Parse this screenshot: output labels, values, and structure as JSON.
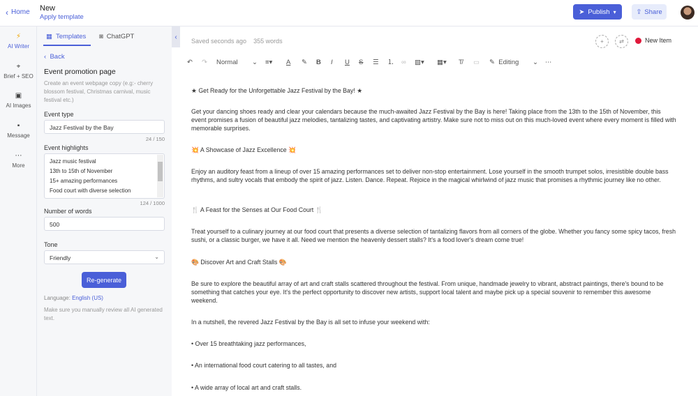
{
  "header": {
    "home_label": "Home",
    "doc_title": "New",
    "apply_template": "Apply template",
    "publish_label": "Publish",
    "share_label": "Share",
    "colors": {
      "accent": "#4a5fd8",
      "share_bg": "#e7ecfb"
    }
  },
  "rail": {
    "items": [
      {
        "label": "AI Writer",
        "icon": "bolt-icon"
      },
      {
        "label": "Brief + SEO",
        "icon": "target-icon"
      },
      {
        "label": "AI Images",
        "icon": "image-icon"
      },
      {
        "label": "Message",
        "icon": "chat-icon"
      },
      {
        "label": "More",
        "icon": "more-icon"
      }
    ]
  },
  "panel": {
    "tabs": [
      {
        "label": "Templates",
        "icon": "grid-icon"
      },
      {
        "label": "ChatGPT",
        "icon": "chat-bubbles-icon"
      }
    ],
    "back_label": "Back",
    "heading": "Event promotion page",
    "description": "Create an event webpage copy (e.g:- cherry blossom festival, Christmas carnival, music festival etc.)",
    "event_type_label": "Event type",
    "event_type_value": "Jazz Festival by the Bay",
    "event_type_count": "24 / 150",
    "highlights_label": "Event highlights",
    "highlights_lines": [
      "Jazz music festival",
      "13th to 15th of November",
      "15+ amazing performances",
      "Food court with diverse selection"
    ],
    "highlights_count": "124 / 1000",
    "words_label": "Number of words",
    "words_value": "500",
    "tone_label": "Tone",
    "tone_value": "Friendly",
    "regenerate_label": "Re-generate",
    "language_label": "Language:",
    "language_value": "English (US)",
    "note": "Make sure you manually review all AI generated text."
  },
  "editor": {
    "saved_status": "Saved seconds ago",
    "word_count": "355 words",
    "new_item_label": "New Item",
    "status_color": "#e0193b",
    "toolbar": {
      "style": "Normal",
      "mode": "Editing",
      "more": "⋯"
    },
    "paragraphs": [
      "★ Get Ready for the Unforgettable Jazz Festival by the Bay! ★",
      "Get your dancing shoes ready and clear your calendars because the much-awaited Jazz Festival by the Bay is here! Taking place from the 13th to the 15th of November, this event promises a fusion of beautiful jazz melodies, tantalizing tastes, and captivating artistry. Make sure not to miss out on this much-loved event where every moment is filled with memorable surprises.",
      "💥 A Showcase of Jazz Excellence 💥",
      "Enjoy an auditory feast from a lineup of over 15 amazing performances set to deliver non-stop entertainment. Lose yourself in the smooth trumpet solos, irresistible double bass rhythms, and sultry vocals that embody the spirit of jazz. Listen. Dance. Repeat. Rejoice in the magical whirlwind of jazz music that promises a rhythmic journey like no other.",
      "🍴 A Feast for the Senses at Our Food Court 🍴",
      "Treat yourself to a culinary journey at our food court that presents a diverse selection of tantalizing flavors from all corners of the globe. Whether you fancy some spicy tacos, fresh sushi, or a classic burger, we have it all. Need we mention the heavenly dessert stalls? It's a food lover's dream come true!",
      "🎨 Discover Art and Craft Stalls 🎨",
      "Be sure to explore the beautiful array of art and craft stalls scattered throughout the festival. From unique, handmade jewelry to vibrant, abstract paintings, there's bound to be something that catches your eye. It's the perfect opportunity to discover new artists, support local talent and maybe pick up a special souvenir to remember this awesome weekend.",
      "In a nutshell, the revered Jazz Festival by the Bay is all set to infuse your weekend with:",
      "• Over 15 breathtaking jazz performances,",
      "• An international food court catering to all tastes, and",
      "• A wide array of local art and craft stalls."
    ]
  }
}
